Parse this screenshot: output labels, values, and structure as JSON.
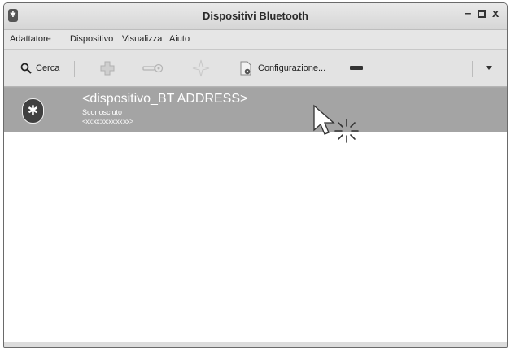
{
  "window": {
    "title": "Dispositivi Bluetooth"
  },
  "menu": [
    "Adattatore",
    "Dispositivo",
    "Visualizza",
    "Aiuto"
  ],
  "toolbar": {
    "search_label": "Cerca",
    "config_label": "Configurazione..."
  },
  "devices": [
    {
      "name": "<dispositivo_BT ADDRESS>",
      "status": "Sconosciuto",
      "address": "<xx:xx:xx:xx:xx:xx>"
    }
  ],
  "colors": {
    "selected_row": "#a4a4a4",
    "list_bg": "#ffffff",
    "chrome_bg": "#dedede"
  }
}
